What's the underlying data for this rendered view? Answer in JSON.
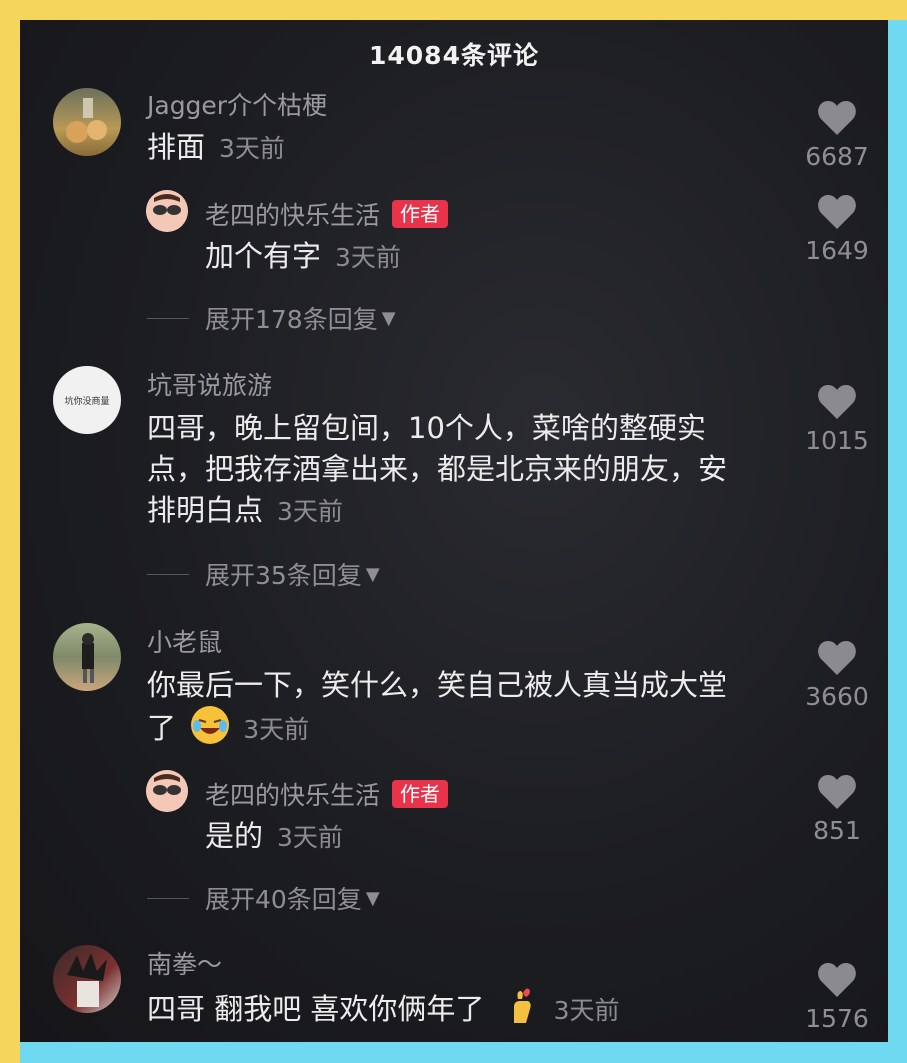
{
  "header": {
    "title": "14084条评论"
  },
  "time_label": "3天前",
  "author_tag": "作者",
  "comments": [
    {
      "user": "Jagger介个枯梗",
      "text": "排面",
      "likes": "6687"
    },
    {
      "user": "老四的快乐生活",
      "text": "加个有字",
      "likes": "1649"
    },
    {
      "expand": "展开178条回复"
    },
    {
      "user": "坑哥说旅游",
      "avatar_text": "坑你没商量",
      "text_lines": [
        "四哥，晚上留包间，10个人，菜啥的整硬实",
        "点，把我存酒拿出来，都是北京来的朋友，安",
        "排明白点"
      ],
      "likes": "1015"
    },
    {
      "expand": "展开35条回复"
    },
    {
      "user": "小老鼠",
      "text_lines": [
        "你最后一下，笑什么，笑自己被人真当成大堂",
        "了"
      ],
      "likes": "3660"
    },
    {
      "user": "老四的快乐生活",
      "text": "是的",
      "likes": "851"
    },
    {
      "expand": "展开40条回复"
    },
    {
      "user": "南拳～",
      "text": "四哥 翻我吧 喜欢你俩年了",
      "likes": "1576"
    }
  ],
  "colors": {
    "author_tag": "#e8334a",
    "background": "#1c1d21",
    "frame_yellow": "#f6d55c",
    "frame_cyan": "#6fd9f2"
  },
  "icons": [
    "heart-icon",
    "caret-down-icon",
    "laughing-emoji-icon",
    "finger-heart-emoji-icon"
  ]
}
